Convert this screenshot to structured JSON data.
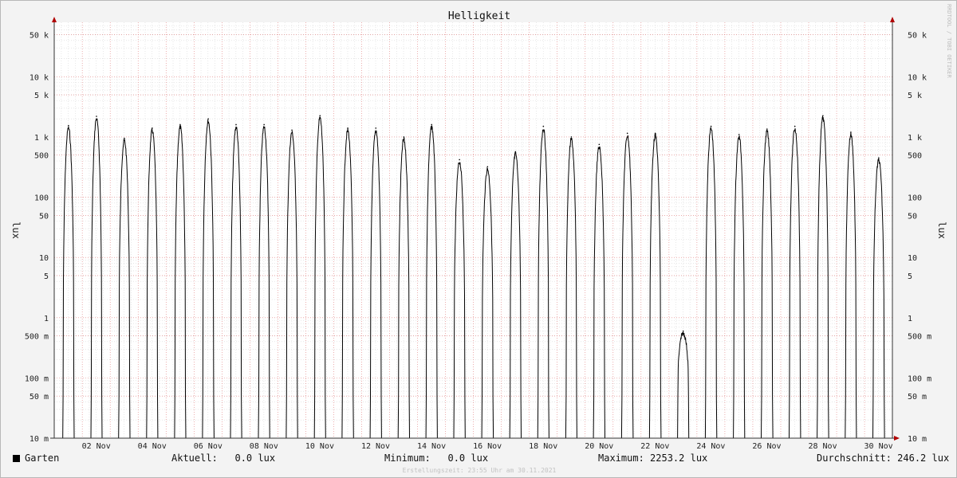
{
  "chart_data": {
    "type": "line",
    "title": "Helligkeit",
    "ylabel": "lux",
    "ylabel_right": "lux",
    "yscale": "log",
    "ylim": [
      0.01,
      80000
    ],
    "xlim": [
      "2021-10-31T23:55",
      "2021-11-30T23:55"
    ],
    "grid": true,
    "y_ticks": [
      {
        "value": 50000,
        "label": "50 k"
      },
      {
        "value": 10000,
        "label": "10 k"
      },
      {
        "value": 5000,
        "label": "5 k"
      },
      {
        "value": 1000,
        "label": "1 k"
      },
      {
        "value": 500,
        "label": "500"
      },
      {
        "value": 100,
        "label": "100"
      },
      {
        "value": 50,
        "label": "50"
      },
      {
        "value": 10,
        "label": "10"
      },
      {
        "value": 5,
        "label": "5"
      },
      {
        "value": 1,
        "label": "1"
      },
      {
        "value": 0.5,
        "label": "500 m"
      },
      {
        "value": 0.1,
        "label": "100 m"
      },
      {
        "value": 0.05,
        "label": "50 m"
      },
      {
        "value": 0.01,
        "label": "10 m"
      }
    ],
    "x_ticks": [
      {
        "value": "2021-11-02",
        "label": "02 Nov"
      },
      {
        "value": "2021-11-04",
        "label": "04 Nov"
      },
      {
        "value": "2021-11-06",
        "label": "06 Nov"
      },
      {
        "value": "2021-11-08",
        "label": "08 Nov"
      },
      {
        "value": "2021-11-10",
        "label": "10 Nov"
      },
      {
        "value": "2021-11-12",
        "label": "12 Nov"
      },
      {
        "value": "2021-11-14",
        "label": "14 Nov"
      },
      {
        "value": "2021-11-16",
        "label": "16 Nov"
      },
      {
        "value": "2021-11-18",
        "label": "18 Nov"
      },
      {
        "value": "2021-11-20",
        "label": "20 Nov"
      },
      {
        "value": "2021-11-22",
        "label": "22 Nov"
      },
      {
        "value": "2021-11-24",
        "label": "24 Nov"
      },
      {
        "value": "2021-11-26",
        "label": "26 Nov"
      },
      {
        "value": "2021-11-28",
        "label": "28 Nov"
      },
      {
        "value": "2021-11-30",
        "label": "30 Nov"
      }
    ],
    "series": [
      {
        "name": "Garten",
        "color": "#000000",
        "daily_peaks": [
          {
            "date": "2021-11-01",
            "lux": 1550
          },
          {
            "date": "2021-11-02",
            "lux": 2200
          },
          {
            "date": "2021-11-03",
            "lux": 950
          },
          {
            "date": "2021-11-04",
            "lux": 1400
          },
          {
            "date": "2021-11-05",
            "lux": 1600
          },
          {
            "date": "2021-11-06",
            "lux": 2000
          },
          {
            "date": "2021-11-07",
            "lux": 1600
          },
          {
            "date": "2021-11-08",
            "lux": 1600
          },
          {
            "date": "2021-11-09",
            "lux": 1300
          },
          {
            "date": "2021-11-10",
            "lux": 2253.2
          },
          {
            "date": "2021-11-11",
            "lux": 1400
          },
          {
            "date": "2021-11-12",
            "lux": 1400
          },
          {
            "date": "2021-11-13",
            "lux": 1000
          },
          {
            "date": "2021-11-14",
            "lux": 1600
          },
          {
            "date": "2021-11-15",
            "lux": 420
          },
          {
            "date": "2021-11-16",
            "lux": 320
          },
          {
            "date": "2021-11-17",
            "lux": 570
          },
          {
            "date": "2021-11-18",
            "lux": 1500
          },
          {
            "date": "2021-11-19",
            "lux": 1000
          },
          {
            "date": "2021-11-20",
            "lux": 750
          },
          {
            "date": "2021-11-21",
            "lux": 1150
          },
          {
            "date": "2021-11-22",
            "lux": 1150
          },
          {
            "date": "2021-11-23",
            "lux": 0.6
          },
          {
            "date": "2021-11-24",
            "lux": 1500
          },
          {
            "date": "2021-11-25",
            "lux": 1100
          },
          {
            "date": "2021-11-26",
            "lux": 1350
          },
          {
            "date": "2021-11-27",
            "lux": 1500
          },
          {
            "date": "2021-11-28",
            "lux": 2253.2
          },
          {
            "date": "2021-11-29",
            "lux": 1200
          },
          {
            "date": "2021-11-30",
            "lux": 450
          }
        ]
      }
    ]
  },
  "legend": {
    "series_name": "Garten",
    "current_label": "Aktuell:",
    "current_value": "0.0 lux",
    "min_label": "Minimum:",
    "min_value": "0.0 lux",
    "max_label": "Maximum:",
    "max_value": "2253.2 lux",
    "avg_label": "Durchschnitt:",
    "avg_value": "246.2 lux"
  },
  "watermark": "RRDTOOL / TOBI OETIKER",
  "created": "Erstellungszeit: 23:55 Uhr am 30.11.2021"
}
